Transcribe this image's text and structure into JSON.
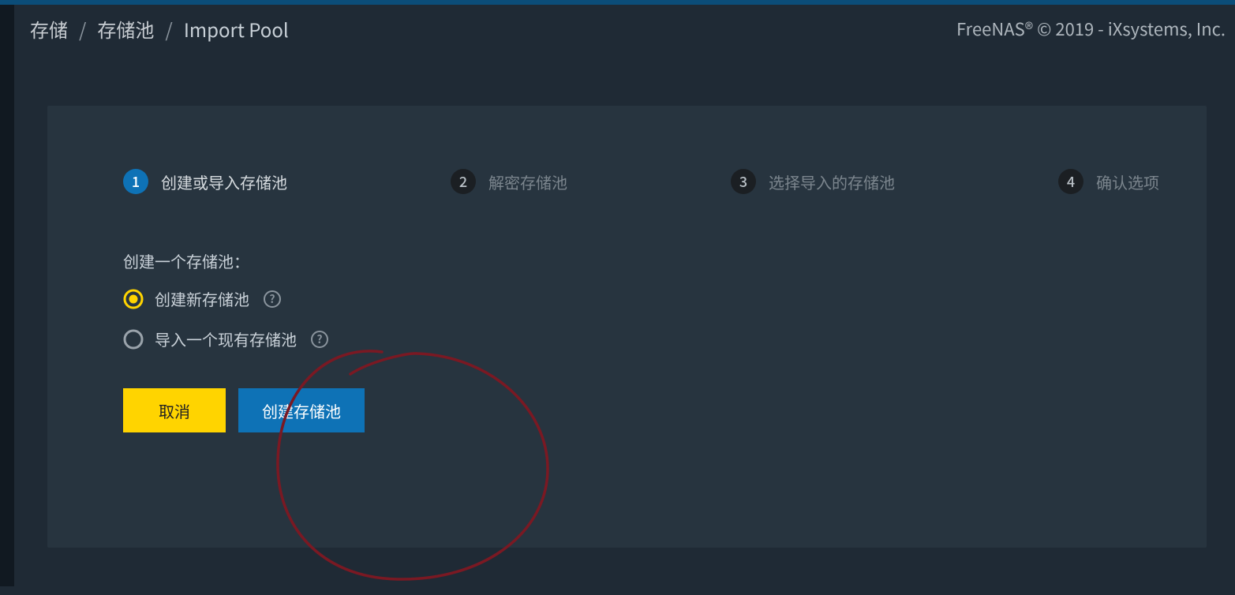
{
  "colors": {
    "accent_blue": "#0e72b6",
    "accent_yellow": "#ffd400",
    "panel": "#27343f",
    "bg": "#1f2a35"
  },
  "breadcrumbs": {
    "a": "存储",
    "b": "存储池",
    "current": "Import Pool",
    "sep": "/"
  },
  "copyright": "FreeNAS® © 2019 - iXsystems, Inc.",
  "steps": [
    {
      "num": "1",
      "label": "创建或导入存储池",
      "active": true
    },
    {
      "num": "2",
      "label": "解密存储池",
      "active": false
    },
    {
      "num": "3",
      "label": "选择导入的存储池",
      "active": false
    },
    {
      "num": "4",
      "label": "确认选项",
      "active": false
    }
  ],
  "section_title": "创建一个存储池：",
  "radios": {
    "create": "创建新存储池",
    "import": "导入一个现有存储池",
    "selected": "create"
  },
  "buttons": {
    "cancel": "取消",
    "create": "创建存储池"
  }
}
